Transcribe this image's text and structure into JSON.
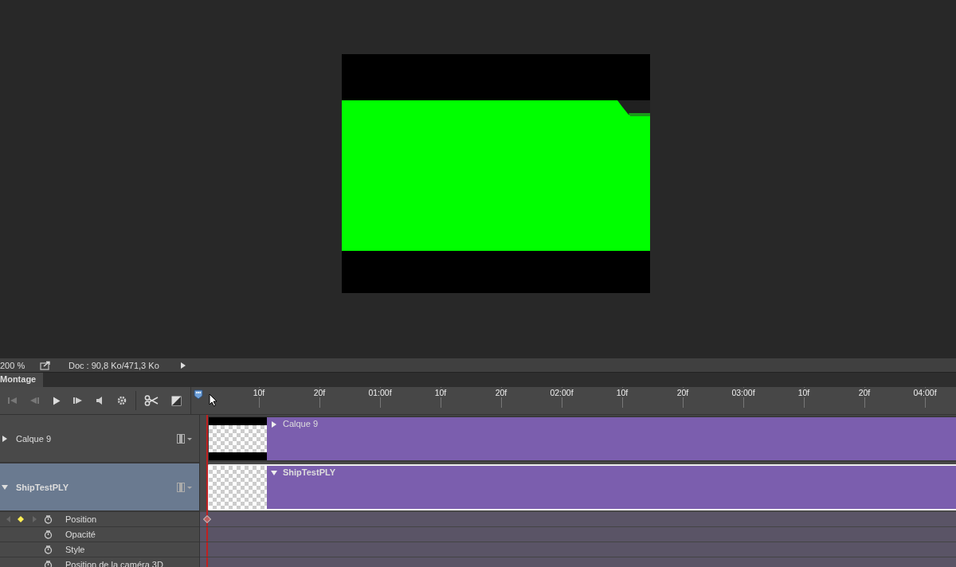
{
  "status_bar": {
    "zoom": "200 %",
    "doc_info": "Doc : 90,8 Ko/471,3 Ko"
  },
  "panel": {
    "title": "Montage"
  },
  "ruler": {
    "labels": [
      "10f",
      "20f",
      "01:00f",
      "10f",
      "20f",
      "02:00f",
      "10f",
      "20f",
      "03:00f",
      "10f",
      "20f",
      "04:00f"
    ]
  },
  "layers": [
    {
      "name": "Calque 9",
      "expanded": false,
      "selected": false
    },
    {
      "name": "ShipTestPLY",
      "expanded": true,
      "selected": true
    }
  ],
  "clips": [
    {
      "label": "Calque 9",
      "kind": "letterbox",
      "expanded": false,
      "selected": false
    },
    {
      "label": "ShipTestPLY",
      "kind": "transparent",
      "expanded": true,
      "selected": true
    }
  ],
  "properties": [
    {
      "name": "Position",
      "keyframed": true
    },
    {
      "name": "Opacité",
      "keyframed": false
    },
    {
      "name": "Style",
      "keyframed": false
    },
    {
      "name": "Position de la caméra 3D",
      "keyframed": false
    }
  ]
}
